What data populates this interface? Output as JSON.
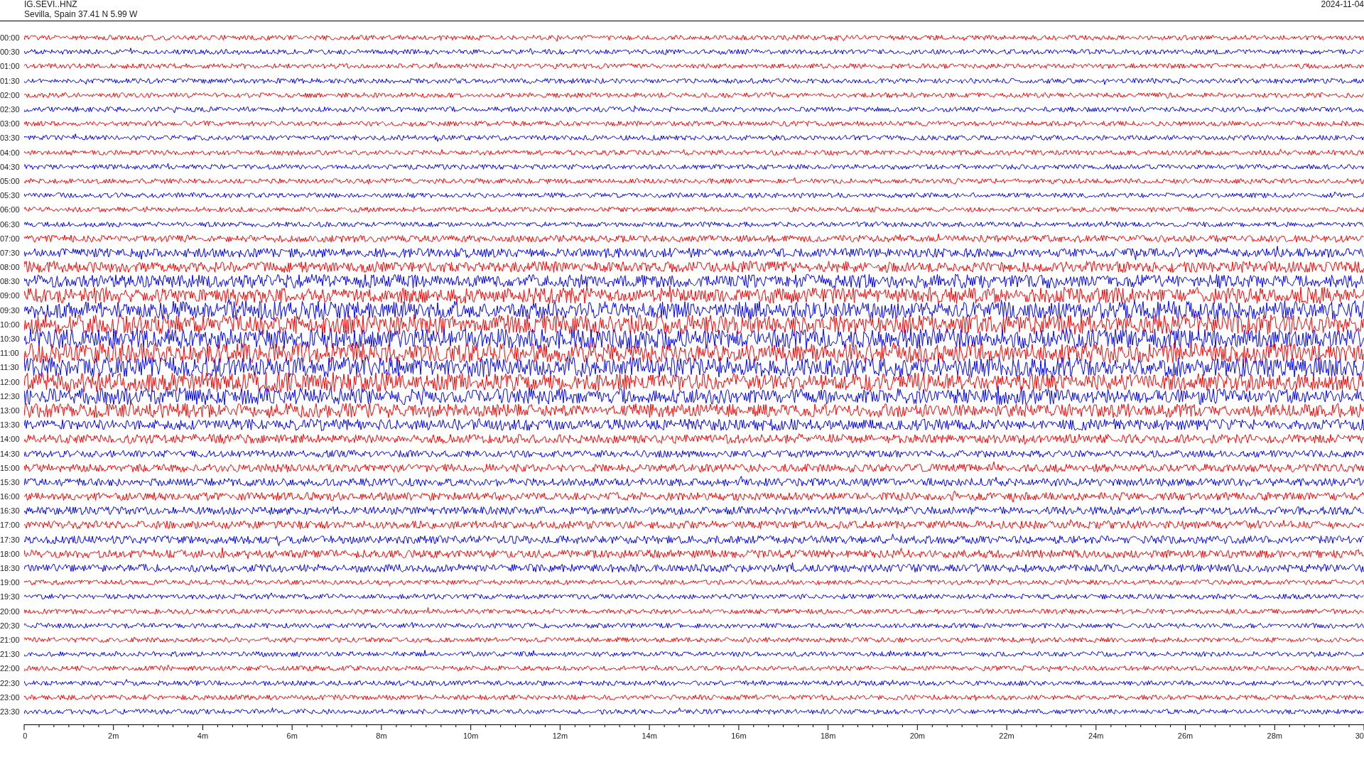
{
  "header": {
    "station": "IG.SEVI..HNZ",
    "location": "Sevilla, Spain  37.41 N 5.99 W",
    "date": "2024-11-04"
  },
  "traces": [
    {
      "time": "00:00",
      "color": "#ff0000"
    },
    {
      "time": "00:30",
      "color": "#0000ff"
    },
    {
      "time": "01:00",
      "color": "#ff0000"
    },
    {
      "time": "01:30",
      "color": "#0000ff"
    },
    {
      "time": "02:00",
      "color": "#ff0000"
    },
    {
      "time": "02:30",
      "color": "#0000ff"
    },
    {
      "time": "03:00",
      "color": "#ff0000"
    },
    {
      "time": "03:30",
      "color": "#0000ff"
    },
    {
      "time": "04:00",
      "color": "#ff0000"
    },
    {
      "time": "04:30",
      "color": "#0000ff"
    },
    {
      "time": "05:00",
      "color": "#ff0000"
    },
    {
      "time": "05:30",
      "color": "#0000ff"
    },
    {
      "time": "06:00",
      "color": "#ff0000"
    },
    {
      "time": "06:30",
      "color": "#0000ff"
    },
    {
      "time": "07:00",
      "color": "#ff0000"
    },
    {
      "time": "07:30",
      "color": "#0000ff"
    },
    {
      "time": "08:00",
      "color": "#ff0000"
    },
    {
      "time": "08:30",
      "color": "#0000ff"
    },
    {
      "time": "09:00",
      "color": "#ff0000"
    },
    {
      "time": "09:30",
      "color": "#0000ff"
    },
    {
      "time": "10:00",
      "color": "#ff0000"
    },
    {
      "time": "10:30",
      "color": "#0000ff"
    },
    {
      "time": "11:00",
      "color": "#ff0000"
    },
    {
      "time": "11:30",
      "color": "#0000ff"
    },
    {
      "time": "12:00",
      "color": "#ff0000"
    },
    {
      "time": "12:30",
      "color": "#0000ff"
    },
    {
      "time": "13:00",
      "color": "#ff0000"
    },
    {
      "time": "13:30",
      "color": "#0000ff"
    },
    {
      "time": "14:00",
      "color": "#ff0000"
    },
    {
      "time": "14:30",
      "color": "#0000ff"
    },
    {
      "time": "15:00",
      "color": "#ff0000"
    },
    {
      "time": "15:30",
      "color": "#0000ff"
    },
    {
      "time": "16:00",
      "color": "#ff0000"
    },
    {
      "time": "16:30",
      "color": "#0000ff"
    },
    {
      "time": "17:00",
      "color": "#ff0000"
    },
    {
      "time": "17:30",
      "color": "#0000ff"
    },
    {
      "time": "18:00",
      "color": "#ff0000"
    },
    {
      "time": "18:30",
      "color": "#0000ff"
    },
    {
      "time": "19:00",
      "color": "#ff0000"
    },
    {
      "time": "19:30",
      "color": "#0000ff"
    },
    {
      "time": "20:00",
      "color": "#ff0000"
    },
    {
      "time": "20:30",
      "color": "#0000ff"
    },
    {
      "time": "21:00",
      "color": "#ff0000"
    },
    {
      "time": "21:30",
      "color": "#0000ff"
    },
    {
      "time": "22:00",
      "color": "#ff0000"
    },
    {
      "time": "22:30",
      "color": "#0000ff"
    },
    {
      "time": "23:00",
      "color": "#ff0000"
    },
    {
      "time": "23:30",
      "color": "#0000ff"
    }
  ],
  "x_axis": {
    "labels": [
      "0",
      "2m",
      "4m",
      "6m",
      "8m",
      "10m",
      "12m",
      "14m",
      "16m",
      "18m",
      "20m",
      "22m",
      "24m",
      "26m",
      "28m",
      "30"
    ]
  }
}
